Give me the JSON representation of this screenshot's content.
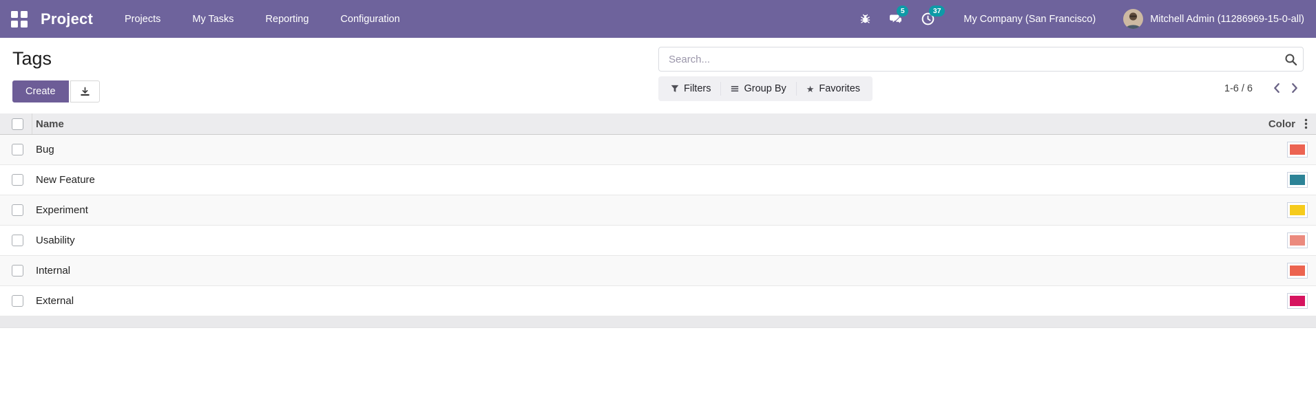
{
  "navbar": {
    "brand": "Project",
    "menu": [
      "Projects",
      "My Tasks",
      "Reporting",
      "Configuration"
    ],
    "badges": {
      "messages": "5",
      "activities": "37"
    },
    "company": "My Company (San Francisco)",
    "user": "Mitchell Admin (11286969-15-0-all)"
  },
  "page": {
    "title": "Tags"
  },
  "toolbar": {
    "create_label": "Create"
  },
  "search": {
    "placeholder": "Search..."
  },
  "filter_bar": {
    "filters_label": "Filters",
    "group_by_label": "Group By",
    "favorites_label": "Favorites"
  },
  "pager": {
    "range": "1-6 / 6"
  },
  "table": {
    "columns": {
      "name": "Name",
      "color": "Color"
    },
    "rows": [
      {
        "name": "Bug",
        "color": "#ec6352",
        "pattern": "solid"
      },
      {
        "name": "New Feature",
        "color": "#2c8397",
        "pattern": "dots"
      },
      {
        "name": "Experiment",
        "color": "#f6cb1c",
        "pattern": "solid"
      },
      {
        "name": "Usability",
        "color": "#eb8a7e",
        "pattern": "dots"
      },
      {
        "name": "Internal",
        "color": "#ec6450",
        "pattern": "solid"
      },
      {
        "name": "External",
        "color": "#d6145f",
        "pattern": "solid"
      }
    ]
  },
  "colors": {
    "navbar_bg": "#6e639c",
    "badge_bg": "#0e9aa7",
    "primary_button": "#6d5d97"
  }
}
